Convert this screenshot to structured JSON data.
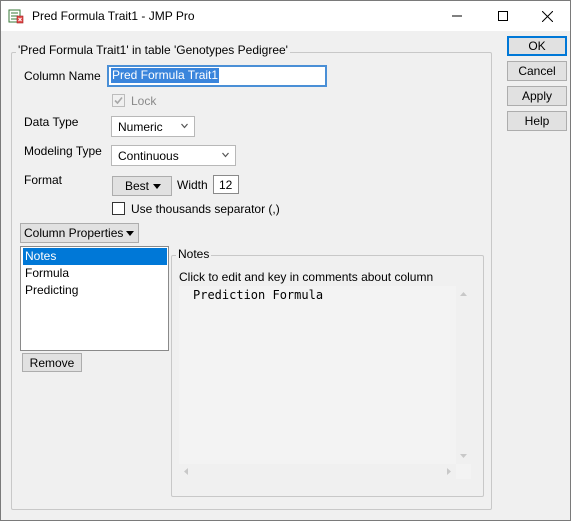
{
  "window": {
    "title": "Pred Formula Trait1 - JMP Pro",
    "controls": {
      "minimize": "—",
      "maximize": "☐",
      "close": "✕"
    }
  },
  "group": {
    "title": "'Pred Formula Trait1' in table 'Genotypes Pedigree'"
  },
  "column_name": {
    "label": "Column Name",
    "value": "Pred Formula Trait1"
  },
  "lock": {
    "label": "Lock",
    "checked": true,
    "disabled": true
  },
  "data_type": {
    "label": "Data Type",
    "value": "Numeric"
  },
  "modeling_type": {
    "label": "Modeling Type",
    "value": "Continuous"
  },
  "format": {
    "label": "Format",
    "value": "Best",
    "width_label": "Width",
    "width_value": "12"
  },
  "thousands": {
    "label": "Use thousands separator (,)",
    "checked": false
  },
  "column_properties": {
    "button_label": "Column Properties",
    "items": [
      {
        "label": "Notes",
        "selected": true
      },
      {
        "label": "Formula",
        "selected": false
      },
      {
        "label": "Predicting",
        "selected": false
      }
    ],
    "remove_label": "Remove"
  },
  "notes_panel": {
    "title": "Notes",
    "instruction": "Click to edit and key in comments about column",
    "text": "Prediction Formula"
  },
  "actions": {
    "ok": "OK",
    "cancel": "Cancel",
    "apply": "Apply",
    "help": "Help"
  },
  "colors": {
    "accent": "#0078d7",
    "selection": "#3a85dc"
  }
}
